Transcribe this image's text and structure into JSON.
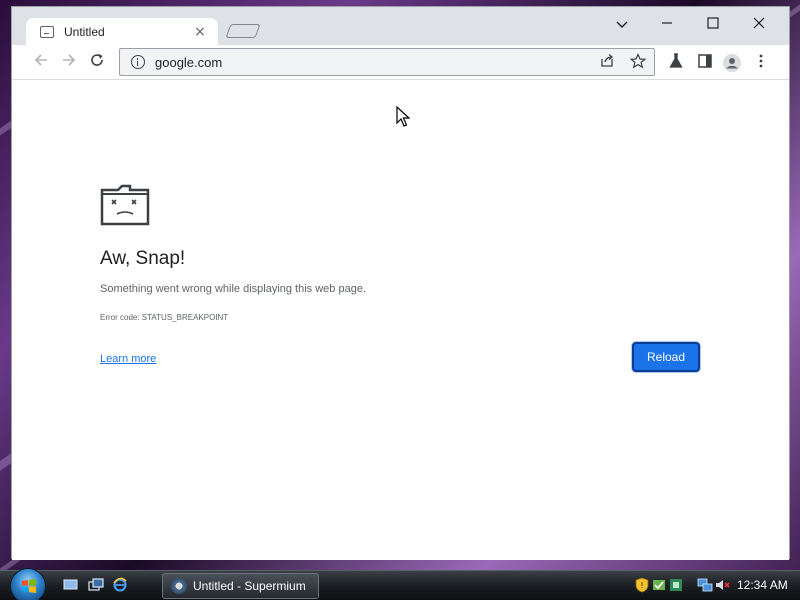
{
  "browser": {
    "tab": {
      "title": "Untitled",
      "close_glyph": "×"
    },
    "window_controls": {
      "minimize": "—",
      "maximize": "☐",
      "close": "✕",
      "dropdown": "⌄"
    },
    "address_bar": {
      "url": "google.com"
    },
    "icons": {
      "back": "back-arrow-icon",
      "forward": "forward-arrow-icon",
      "reload": "reload-icon",
      "info": "info-icon",
      "share": "share-icon",
      "bookmark": "star-icon",
      "labs": "flask-icon",
      "side_panel": "side-panel-icon",
      "profile": "profile-icon",
      "menu": "kebab-menu-icon"
    }
  },
  "error_page": {
    "title": "Aw, Snap!",
    "message": "Something went wrong while displaying this web page.",
    "error_code": "Error code: STATUS_BREAKPOINT",
    "learn_more": "Learn more",
    "reload_button": "Reload"
  },
  "taskbar": {
    "task_button_label": "Untitled - Supermium",
    "clock": "12:34 AM"
  },
  "colors": {
    "accent": "#1a73e8",
    "tab_strip": "#dee1e6",
    "text_primary": "#202124",
    "text_secondary": "#5f6368"
  }
}
